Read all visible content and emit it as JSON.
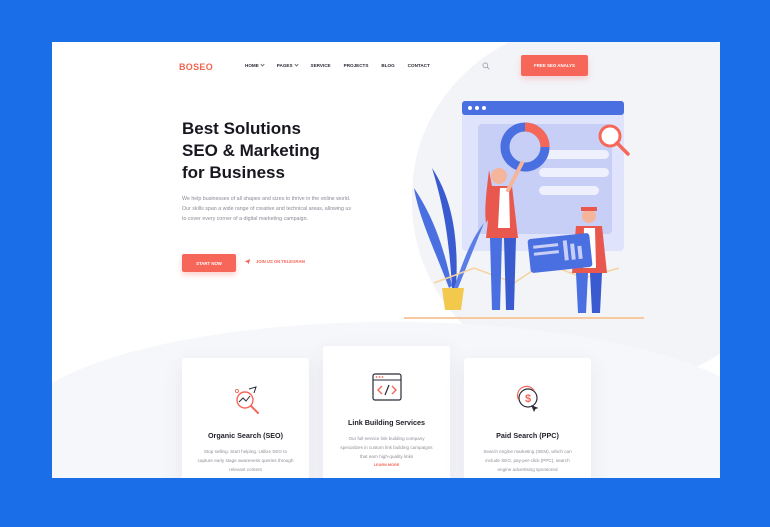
{
  "header": {
    "logo": "BOSEO",
    "nav": [
      {
        "label": "HOME",
        "has_dropdown": true
      },
      {
        "label": "PAGES",
        "has_dropdown": true
      },
      {
        "label": "SERVICE",
        "has_dropdown": false
      },
      {
        "label": "PROJECTS",
        "has_dropdown": false
      },
      {
        "label": "BLOG",
        "has_dropdown": false
      },
      {
        "label": "CONTACT",
        "has_dropdown": false
      }
    ],
    "search_icon": "search-icon",
    "cta_label": "FREE SEO ANALYS"
  },
  "hero": {
    "title_lines": [
      "Best Solutions",
      "SEO & Marketing",
      "for Business"
    ],
    "text": "We help businesses of all shapes and sizes to thrive in the online world. Our skills span a wide range of creative and technical areas, allowing us to cover every corner of a digital marketing campaign.",
    "start_label": "START NOW",
    "telegram_label": "JOIN US ON TELEGRAM"
  },
  "cards": [
    {
      "icon": "analytics-magnifier-icon",
      "title": "Organic Search (SEO)",
      "text": "Stop selling. Start helping. Utilize SEO to capture early stage awareness queries through relevant content"
    },
    {
      "icon": "code-window-icon",
      "title": "Link Building Services",
      "text": "Our full-service link building company specializes in custom link building campaigns that earn high-quality links",
      "link": "LEARN MORE"
    },
    {
      "icon": "dollar-cursor-icon",
      "title": "Paid Search (PPC)",
      "text": "Search engine marketing (SEM), which can include SEO, pay-per-click (PPC), search engine advertising sponsored"
    }
  ],
  "colors": {
    "accent": "#f6675a",
    "frame": "#1a6ee8",
    "illustration_blue": "#4a6fe0"
  }
}
